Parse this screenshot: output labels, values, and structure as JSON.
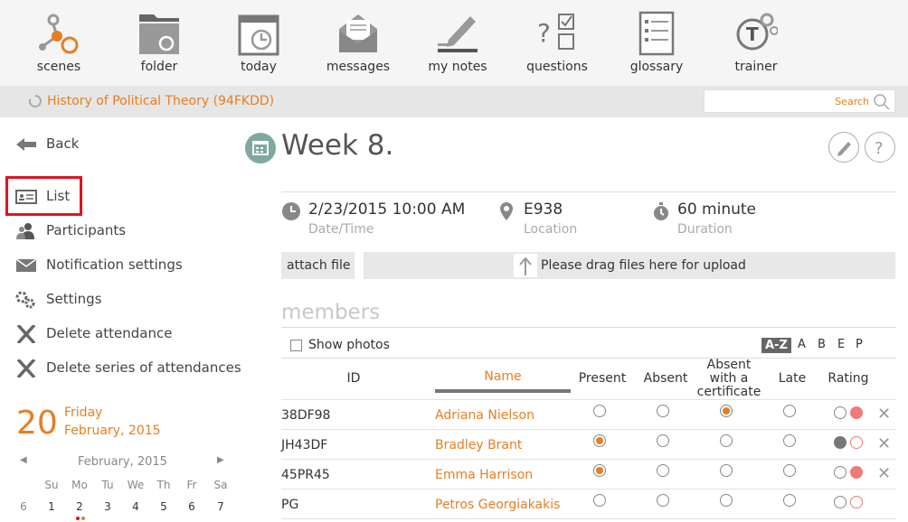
{
  "nav": {
    "scenes": "scenes",
    "folder": "folder",
    "today": "today",
    "messages": "messages",
    "my_notes": "my notes",
    "questions": "questions",
    "glossary": "glossary",
    "trainer": "trainer"
  },
  "course": {
    "title": "History of Political Theory (94FKDD)"
  },
  "search": {
    "label": "Search"
  },
  "sidebar": {
    "back": "Back",
    "list": "List",
    "participants": "Participants",
    "notifications": "Notification settings",
    "settings": "Settings",
    "delete_attendance": "Delete attendance",
    "delete_series": "Delete series of attendances"
  },
  "calendar": {
    "day": "20",
    "weekday": "Friday",
    "month_year": "February, 2015",
    "title": "February, 2015",
    "weekdays": [
      "Su",
      "Mo",
      "Tu",
      "We",
      "Th",
      "Fr",
      "Sa"
    ],
    "numbers": [
      "6",
      "1",
      "2",
      "3",
      "4",
      "5",
      "6",
      "7"
    ]
  },
  "event": {
    "title": "Week 8.",
    "datetime": "2/23/2015 10:00 AM",
    "datetime_label": "Date/Time",
    "location": "E938",
    "location_label": "Location",
    "duration": "60 minute",
    "duration_label": "Duration"
  },
  "upload": {
    "attach": "attach file",
    "drop": "Please drag files here for upload"
  },
  "members": {
    "title": "members",
    "show_photos": "Show photos",
    "sort": [
      "A-Z",
      "A",
      "B",
      "E",
      "P"
    ],
    "columns": {
      "id": "ID",
      "name": "Name",
      "present": "Present",
      "absent": "Absent",
      "cert_1": "Absent",
      "cert_2": "with a",
      "cert_3": "certificate",
      "late": "Late",
      "rating": "Rating"
    },
    "rows": [
      {
        "id": "38DF98",
        "name": "Adriana Nielson",
        "status": "certificate"
      },
      {
        "id": "JH43DF",
        "name": "Bradley Brant",
        "status": "present"
      },
      {
        "id": "45PR45",
        "name": "Emma Harrison",
        "status": "present"
      },
      {
        "id": "PG",
        "name": "Petros Georgiakakis",
        "status": "none"
      }
    ]
  }
}
